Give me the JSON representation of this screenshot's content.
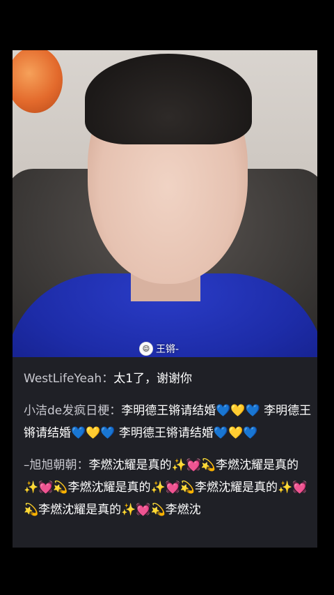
{
  "stream": {
    "streamer_name": "王锵-"
  },
  "comments": [
    {
      "author": "WestLifeYeah：",
      "text": "太1了，谢谢你"
    },
    {
      "author": "小洁de发疯日梗：",
      "text": "李明德王锵请结婚💙💛💙 李明德王锵请结婚💙💛💙 李明德王锵请结婚💙💛💙"
    },
    {
      "author": "–旭旭朝朝：",
      "text": "李燃沈耀是真的✨💓💫李燃沈耀是真的✨💓💫李燃沈耀是真的✨💓💫李燃沈耀是真的✨💓💫李燃沈耀是真的✨💓💫李燃沈"
    }
  ]
}
